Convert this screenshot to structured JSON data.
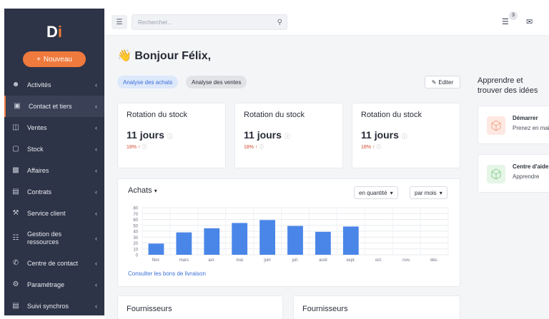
{
  "sidebar": {
    "logo_main": "D",
    "logo_accent": "i",
    "new_button": "Nouveau",
    "items": [
      {
        "label": "Activités",
        "icon": "users-icon"
      },
      {
        "label": "Contact et tiers",
        "icon": "address-book-icon",
        "active": true
      },
      {
        "label": "Ventes",
        "icon": "money-icon"
      },
      {
        "label": "Stock",
        "icon": "box-icon"
      },
      {
        "label": "Affaires",
        "icon": "briefcase-icon"
      },
      {
        "label": "Contrats",
        "icon": "contract-icon"
      },
      {
        "label": "Service client",
        "icon": "wrench-icon"
      },
      {
        "label": "Gestion des ressources",
        "icon": "sitemap-icon"
      },
      {
        "label": "Centre de contact",
        "icon": "phone-icon"
      },
      {
        "label": "Paramétrage",
        "icon": "gear-icon"
      },
      {
        "label": "Suivi synchros",
        "icon": "chart-icon"
      }
    ]
  },
  "topbar": {
    "search_placeholder": "Rechercher...",
    "tasks_count": "3"
  },
  "main": {
    "greeting": "Bonjour Félix,",
    "tabs": [
      {
        "label": "Analyse des achats",
        "active": true
      },
      {
        "label": "Analyse des ventes",
        "active": false
      }
    ],
    "edit_button": "Editer",
    "kpis": [
      {
        "title": "Rotation du stock",
        "value": "11 jours",
        "change": "18%"
      },
      {
        "title": "Rotation du stock",
        "value": "11 jours",
        "change": "18%"
      },
      {
        "title": "Rotation du stock",
        "value": "11 jours",
        "change": "18%"
      }
    ],
    "chart_card": {
      "title": "Achats",
      "select_quantity": "en quantité",
      "select_period": "par mois",
      "link": "Consulter les bons de livraison"
    },
    "bottom_cards": [
      "Fournisseurs",
      "Fournisseurs"
    ]
  },
  "right_panel": {
    "title": "Apprendre et trouver des idées",
    "cards": [
      {
        "title": "Démarrer",
        "desc": "Prenez en main",
        "color": "#fde9e2",
        "icon_color": "#f3a58b"
      },
      {
        "title": "Centre d'aide",
        "desc": "Apprendre",
        "color": "#e5f5e6",
        "icon_color": "#8ccf92"
      }
    ]
  },
  "chart_data": {
    "type": "bar",
    "categories": [
      "févr.",
      "mars",
      "avr.",
      "mai",
      "juin",
      "juil.",
      "août",
      "sept.",
      "oct.",
      "nov.",
      "déc."
    ],
    "values": [
      19,
      38,
      45,
      54,
      59,
      49,
      39,
      48,
      0,
      0,
      0
    ],
    "ylim": [
      0,
      80
    ],
    "yticks": [
      0,
      10,
      20,
      30,
      40,
      50,
      60,
      70,
      80
    ],
    "bar_color": "#4a86e8",
    "grid": true
  }
}
